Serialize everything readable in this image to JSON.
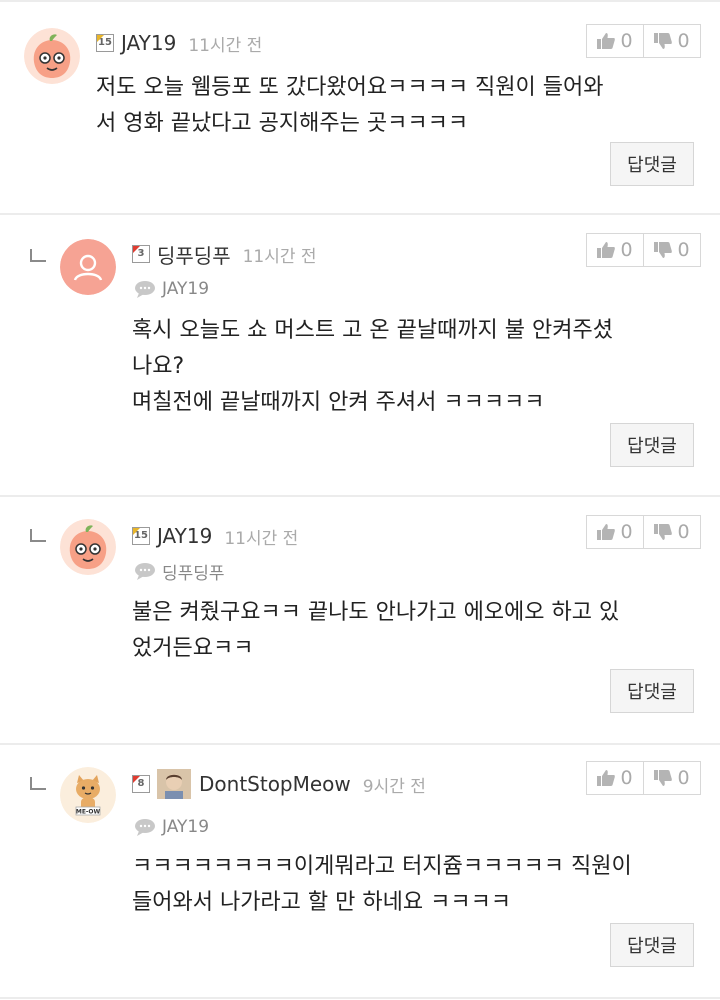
{
  "reply_button_label": "답댓글",
  "comments": [
    {
      "author": "JAY19",
      "level": "15",
      "time": "11시간 전",
      "reply_to": "",
      "body": [
        "저도 오늘 웸등포 또 갔다왔어요ㅋㅋㅋㅋ 직원이 들어와",
        "서 영화 끝났다고 공지해주는 곳ㅋㅋㅋㅋ"
      ],
      "likes": "0",
      "dislikes": "0",
      "avatar": "peach-character",
      "is_reply": false
    },
    {
      "author": "딩푸딩푸",
      "level": "3",
      "time": "11시간 전",
      "reply_to": "JAY19",
      "body": [
        "혹시 오늘도 쇼 머스트 고 온 끝날때까지 불 안켜주셨",
        "나요?",
        "며칠전에 끝날때까지 안켜 주셔서 ㅋㅋㅋㅋㅋ"
      ],
      "likes": "0",
      "dislikes": "0",
      "avatar": "default-user",
      "is_reply": true
    },
    {
      "author": "JAY19",
      "level": "15",
      "time": "11시간 전",
      "reply_to": "딩푸딩푸",
      "body": [
        "불은 켜줬구요ㅋㅋ 끝나도 안나가고 에오에오 하고 있",
        "었거든요ㅋㅋ"
      ],
      "likes": "0",
      "dislikes": "0",
      "avatar": "peach-character",
      "is_reply": true
    },
    {
      "author": "DontStopMeow",
      "level": "8",
      "time": "9시간 전",
      "reply_to": "JAY19",
      "body": [
        "ㅋㅋㅋㅋㅋㅋㅋㅋ이게뭐라고 터지쥼ㅋㅋㅋㅋㅋ 직원이",
        "들어와서 나가라고 할 만 하네요 ㅋㅋㅋㅋ"
      ],
      "likes": "0",
      "dislikes": "0",
      "avatar": "cat-sticker",
      "is_reply": true
    }
  ]
}
